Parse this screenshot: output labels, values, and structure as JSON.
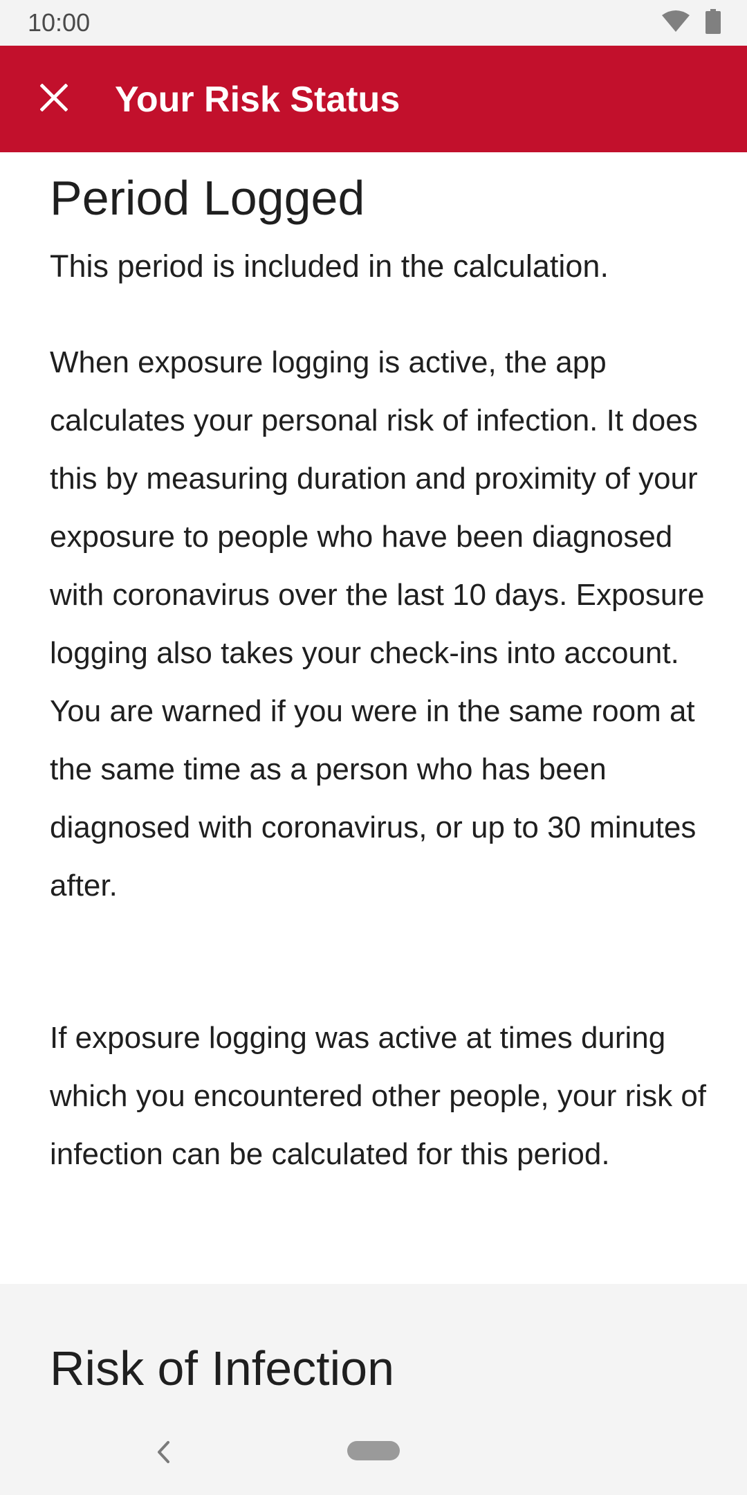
{
  "status_bar": {
    "time": "10:00"
  },
  "app_bar": {
    "title": "Your Risk Status",
    "close_icon": "close-icon"
  },
  "period_logged": {
    "title": "Period Logged",
    "subtitle": "This period is included in the calculation.",
    "paragraph_1": "When exposure logging is active, the app calculates your personal risk of infection. It does this by measuring duration and proximity of your exposure to people who have been diagnosed with coronavirus over the last 10 days. Exposure logging also takes your check-ins into account. You are warned if you were in the same room at the same time as a person who has been diagnosed with coronavirus, or up to 30 minutes after.",
    "paragraph_2": "If exposure logging was active at times during which you encountered other people, your risk of infection can be calculated for this period."
  },
  "risk_of_infection": {
    "title": "Risk of Infection"
  },
  "colors": {
    "app_bar": "#c2102c",
    "status_bar": "#f3f3f3",
    "section_gray": "#f4f4f4",
    "text": "#1f1f1f"
  },
  "icons": {
    "wifi": "wifi-icon",
    "battery": "battery-icon",
    "back": "back-chevron-icon",
    "home": "home-pill"
  }
}
